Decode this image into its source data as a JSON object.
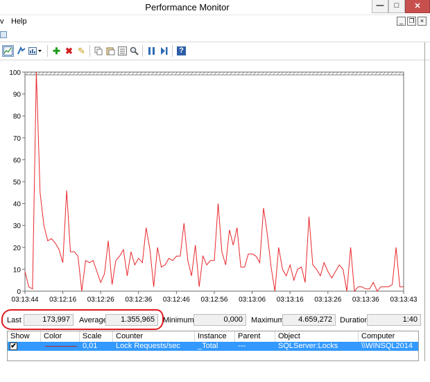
{
  "window": {
    "title": "Performance Monitor",
    "min_glyph": "—",
    "max_glyph": "□",
    "close_glyph": "✕"
  },
  "menu": {
    "view_label": "v",
    "help_label": "Help",
    "mdi_min": "_",
    "mdi_restore": "❐",
    "mdi_close": "×"
  },
  "toolbar": {
    "icons": [
      "view-graph-icon",
      "view-current-activity-icon",
      "change-graph-type-icon",
      "add-counter-icon",
      "delete-counter-icon",
      "highlight-icon",
      "copy-properties-icon",
      "paste-counter-list-icon",
      "properties-icon",
      "zoom-icon",
      "freeze-display-icon",
      "update-data-icon",
      "help-icon"
    ],
    "add_glyph": "✚",
    "delete_glyph": "✖",
    "highlight_glyph": "✎",
    "zoom_glyph": "🔍",
    "help_glyph": "?"
  },
  "graph": {
    "y_ticks": [
      "100",
      "90",
      "80",
      "70",
      "60",
      "50",
      "40",
      "30",
      "20",
      "10",
      "0"
    ],
    "x_ticks": [
      "03:13:44",
      "03:12:16",
      "03:12:26",
      "03:12:36",
      "03:12:46",
      "03:12:56",
      "03:13:06",
      "03:13:16",
      "03:13:26",
      "03:13:36",
      "03:13:43"
    ],
    "line_color": "#e8262a"
  },
  "chart_data": {
    "type": "line",
    "ylim": [
      0,
      100
    ],
    "series": [
      {
        "values": [
          9,
          2,
          1,
          100,
          45,
          30,
          23,
          24,
          22,
          19,
          13,
          46,
          18,
          18,
          16,
          0,
          14,
          13,
          14,
          9,
          4,
          8,
          23,
          3,
          14,
          16,
          19,
          7,
          18,
          12,
          15,
          13,
          29,
          19,
          2,
          20,
          11,
          12,
          15,
          14,
          16,
          16,
          31,
          14,
          7,
          21,
          2,
          16,
          12,
          14,
          14,
          40,
          18,
          12,
          28,
          21,
          29,
          11,
          11,
          17,
          17,
          16,
          13,
          38,
          26,
          11,
          0,
          20,
          10,
          7,
          12,
          5,
          10,
          11,
          4,
          34,
          12,
          10,
          7,
          13,
          9,
          6,
          9,
          12,
          10,
          0,
          20,
          0,
          2,
          2,
          1,
          1,
          4,
          0,
          2,
          2,
          2,
          3,
          20,
          2,
          2
        ]
      }
    ]
  },
  "stats": {
    "last_label": "Last",
    "last_value": "173,997",
    "average_label": "Average",
    "average_value": "1.355,965",
    "minimum_label": "Minimum",
    "minimum_value": "0,000",
    "maximum_label": "Maximum",
    "maximum_value": "4.659,272",
    "duration_label": "Duration",
    "duration_value": "1:40"
  },
  "counters": {
    "headers": [
      "Show",
      "Color",
      "Scale",
      "Counter",
      "Instance",
      "Parent",
      "Object",
      "Computer"
    ],
    "row": {
      "show_checked": "✔",
      "scale": "0,01",
      "counter": "Lock Requests/sec",
      "instance": "_Total",
      "parent": "---",
      "object": "SQLServer:Locks",
      "computer": "\\\\WINSQL2014"
    }
  }
}
